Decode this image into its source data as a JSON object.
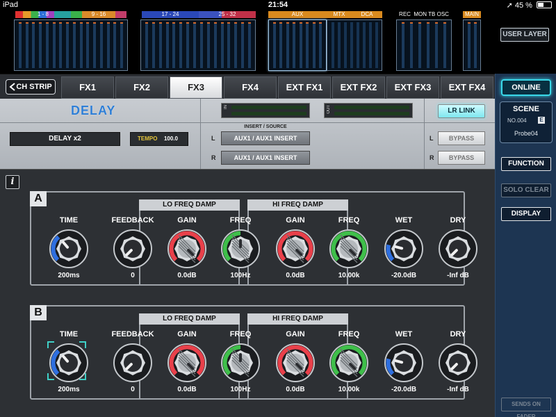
{
  "status": {
    "device": "iPad",
    "time": "21:54",
    "battery": "45 %",
    "battery_level": 0.45
  },
  "meters": {
    "groups": [
      "1 - 8",
      "9 - 16",
      "17 - 24",
      "25 - 32",
      "AUX",
      "MTX",
      "DCA",
      "REC",
      "MON",
      "TB",
      "OSC",
      "MAIN"
    ],
    "user_layer": "USER LAYER"
  },
  "tabs": {
    "ch_strip": "CH STRIP",
    "items": [
      "FX1",
      "FX2",
      "FX3",
      "FX4",
      "EXT FX1",
      "EXT FX2",
      "EXT FX3",
      "EXT FX4"
    ],
    "active": "FX3"
  },
  "sidebar": {
    "online": "ONLINE",
    "scene_title": "SCENE",
    "scene_no": "NO.004",
    "scene_badge": "E",
    "scene_name": "Probe04",
    "function": "FUNCTION",
    "solo_clear": "SOLO CLEAR",
    "display": "DISPLAY",
    "sends_on_fader": "SENDS ON FADER"
  },
  "fx": {
    "name": "DELAY",
    "in_label": "IN",
    "out_label": "OUT",
    "lr_link": "LR LINK",
    "type": "DELAY x2",
    "tempo_label": "TEMPO",
    "tempo_value": "100.0",
    "insert_label": "INSERT / SOURCE",
    "l": "L",
    "r": "R",
    "insert_l": "AUX1 / AUX1 INSERT",
    "insert_r": "AUX1 / AUX1 INSERT",
    "bypass_l": "BYPASS",
    "bypass_r": "BYPASS"
  },
  "colors": {
    "accent": "#39d8e8",
    "knob_blue": "#2e6fe0",
    "knob_red": "#e9404a",
    "knob_green": "#3fbf4a"
  },
  "panels": [
    {
      "letter": "A",
      "group_lo": "LO FREQ DAMP",
      "group_hi": "HI FREQ DAMP",
      "knobs": [
        {
          "label": "TIME",
          "value": "200ms",
          "color": "blue",
          "level": 0.35
        },
        {
          "label": "FEEDBACK",
          "value": "0",
          "color": "none",
          "level": 0
        },
        {
          "label": "GAIN",
          "value": "0.0dB",
          "color": "red",
          "level": 1
        },
        {
          "label": "FREQ",
          "value": "100Hz",
          "color": "green",
          "level": 0.5
        },
        {
          "label": "GAIN",
          "value": "0.0dB",
          "color": "red",
          "level": 1
        },
        {
          "label": "FREQ",
          "value": "10.00k",
          "color": "green",
          "level": 1
        },
        {
          "label": "WET",
          "value": "-20.0dB",
          "color": "blue",
          "level": 0.22
        },
        {
          "label": "DRY",
          "value": "-Inf dB",
          "color": "none",
          "level": 0
        }
      ]
    },
    {
      "letter": "B",
      "group_lo": "LO FREQ DAMP",
      "group_hi": "HI FREQ DAMP",
      "knobs": [
        {
          "label": "TIME",
          "value": "200ms",
          "color": "blue",
          "level": 0.35
        },
        {
          "label": "FEEDBACK",
          "value": "0",
          "color": "none",
          "level": 0
        },
        {
          "label": "GAIN",
          "value": "0.0dB",
          "color": "red",
          "level": 1
        },
        {
          "label": "FREQ",
          "value": "100Hz",
          "color": "green",
          "level": 0.5
        },
        {
          "label": "GAIN",
          "value": "0.0dB",
          "color": "red",
          "level": 1
        },
        {
          "label": "FREQ",
          "value": "10.00k",
          "color": "green",
          "level": 1
        },
        {
          "label": "WET",
          "value": "-20.0dB",
          "color": "blue",
          "level": 0.22
        },
        {
          "label": "DRY",
          "value": "-Inf dB",
          "color": "none",
          "level": 0
        }
      ]
    }
  ]
}
